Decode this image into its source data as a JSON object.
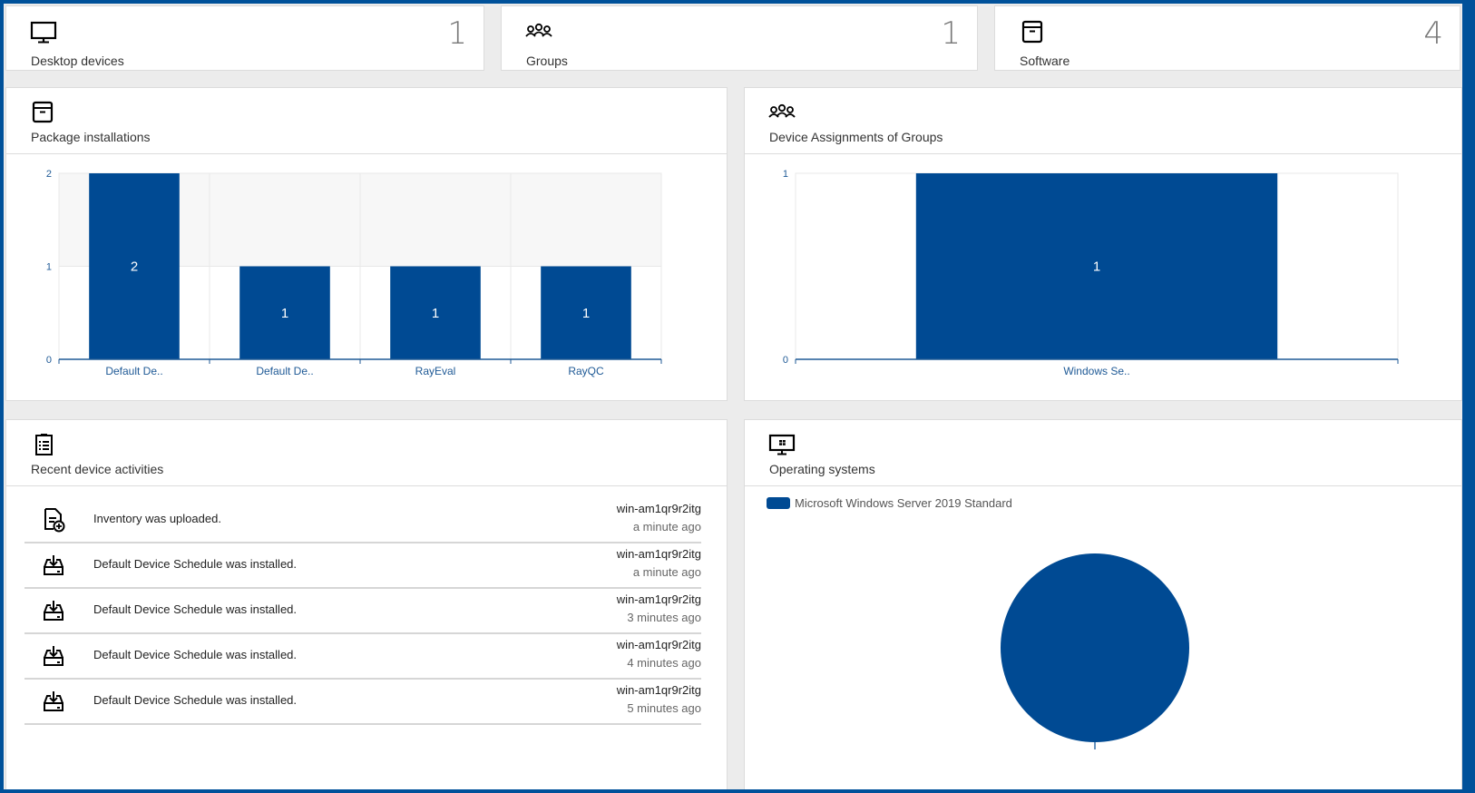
{
  "colors": {
    "brand": "#00519a",
    "bar": "#004a93",
    "grid": "#e8e8e8",
    "axis": "#1f5a96"
  },
  "kpis": [
    {
      "label": "Desktop devices",
      "count": "1",
      "icon": "monitor-icon"
    },
    {
      "label": "Groups",
      "count": "1",
      "icon": "groups-icon"
    },
    {
      "label": "Software",
      "count": "4",
      "icon": "package-box-icon"
    }
  ],
  "panels": {
    "package_installations": {
      "title": "Package installations",
      "icon": "package-box-icon"
    },
    "device_assignments": {
      "title": "Device Assignments of Groups",
      "icon": "groups-icon"
    },
    "recent_activities": {
      "title": "Recent device activities",
      "icon": "clipboard-list-icon"
    },
    "operating_systems": {
      "title": "Operating systems",
      "icon": "windows-monitor-icon"
    }
  },
  "activities": [
    {
      "icon": "document-add-icon",
      "subject": "Inventory",
      "action": " was uploaded.",
      "device": "win-am1qr9r2itg",
      "time": "a minute ago"
    },
    {
      "icon": "tray-download-icon",
      "subject": "Default Device Schedule",
      "action": " was installed.",
      "device": "win-am1qr9r2itg",
      "time": "a minute ago"
    },
    {
      "icon": "tray-download-icon",
      "subject": "Default Device Schedule",
      "action": " was installed.",
      "device": "win-am1qr9r2itg",
      "time": "3 minutes ago"
    },
    {
      "icon": "tray-download-icon",
      "subject": "Default Device Schedule",
      "action": " was installed.",
      "device": "win-am1qr9r2itg",
      "time": "4 minutes ago"
    },
    {
      "icon": "tray-download-icon",
      "subject": "Default Device Schedule",
      "action": " was installed.",
      "device": "win-am1qr9r2itg",
      "time": "5 minutes ago"
    }
  ],
  "chart_data": [
    {
      "id": "package_installations",
      "type": "bar",
      "title": "Package installations",
      "categories": [
        "Default De..",
        "Default De..",
        "RayEval",
        "RayQC"
      ],
      "values": [
        2,
        1,
        1,
        1
      ],
      "data_labels": [
        "2",
        "1",
        "1",
        "1"
      ],
      "yticks": [
        "0",
        "1",
        "2"
      ],
      "ylim": [
        0,
        2
      ],
      "xlabel": "",
      "ylabel": "",
      "grid": true
    },
    {
      "id": "device_assignments",
      "type": "bar",
      "title": "Device Assignments of Groups",
      "categories": [
        "Windows Se.."
      ],
      "values": [
        1
      ],
      "data_labels": [
        "1"
      ],
      "yticks": [
        "0",
        "1"
      ],
      "ylim": [
        0,
        1
      ],
      "xlabel": "",
      "ylabel": "",
      "grid": true
    },
    {
      "id": "operating_systems",
      "type": "pie",
      "title": "Operating systems",
      "labels": [
        "Microsoft Windows Server 2019 Standard"
      ],
      "values": [
        1
      ],
      "legend": "top-left"
    }
  ]
}
